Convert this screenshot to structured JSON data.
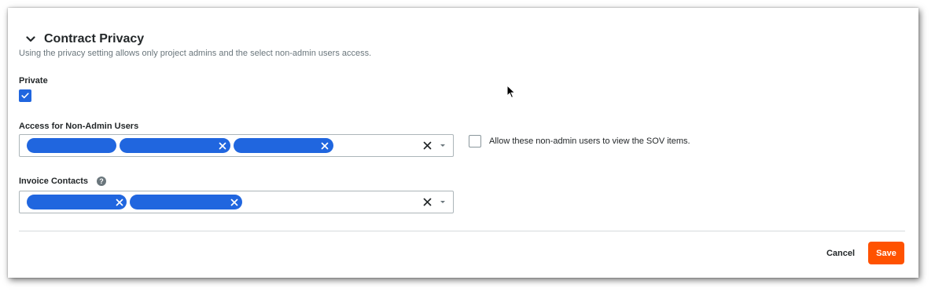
{
  "section": {
    "title": "Contract Privacy",
    "description": "Using the privacy setting allows only project admins and the select non-admin users access.",
    "toggle_icon": "chevron-down-icon"
  },
  "private": {
    "label": "Private",
    "checked": true
  },
  "non_admin_access": {
    "label": "Access for Non-Admin Users",
    "selected_count": 3,
    "clear_icon": "close-icon",
    "dropdown_icon": "caret-down-icon"
  },
  "sov_option": {
    "label": "Allow these non-admin users to view the SOV items.",
    "checked": false
  },
  "invoice_contacts": {
    "label": "Invoice Contacts",
    "help_icon": "question-circle-icon",
    "help_glyph": "?",
    "selected_count": 2,
    "clear_icon": "close-icon",
    "dropdown_icon": "caret-down-icon"
  },
  "actions": {
    "cancel_label": "Cancel",
    "save_label": "Save"
  },
  "colors": {
    "accent_blue": "#2066df",
    "save_orange": "#ff5200",
    "text_dark": "#232729",
    "text_muted": "#6a767c",
    "border": "#acb5b9"
  }
}
